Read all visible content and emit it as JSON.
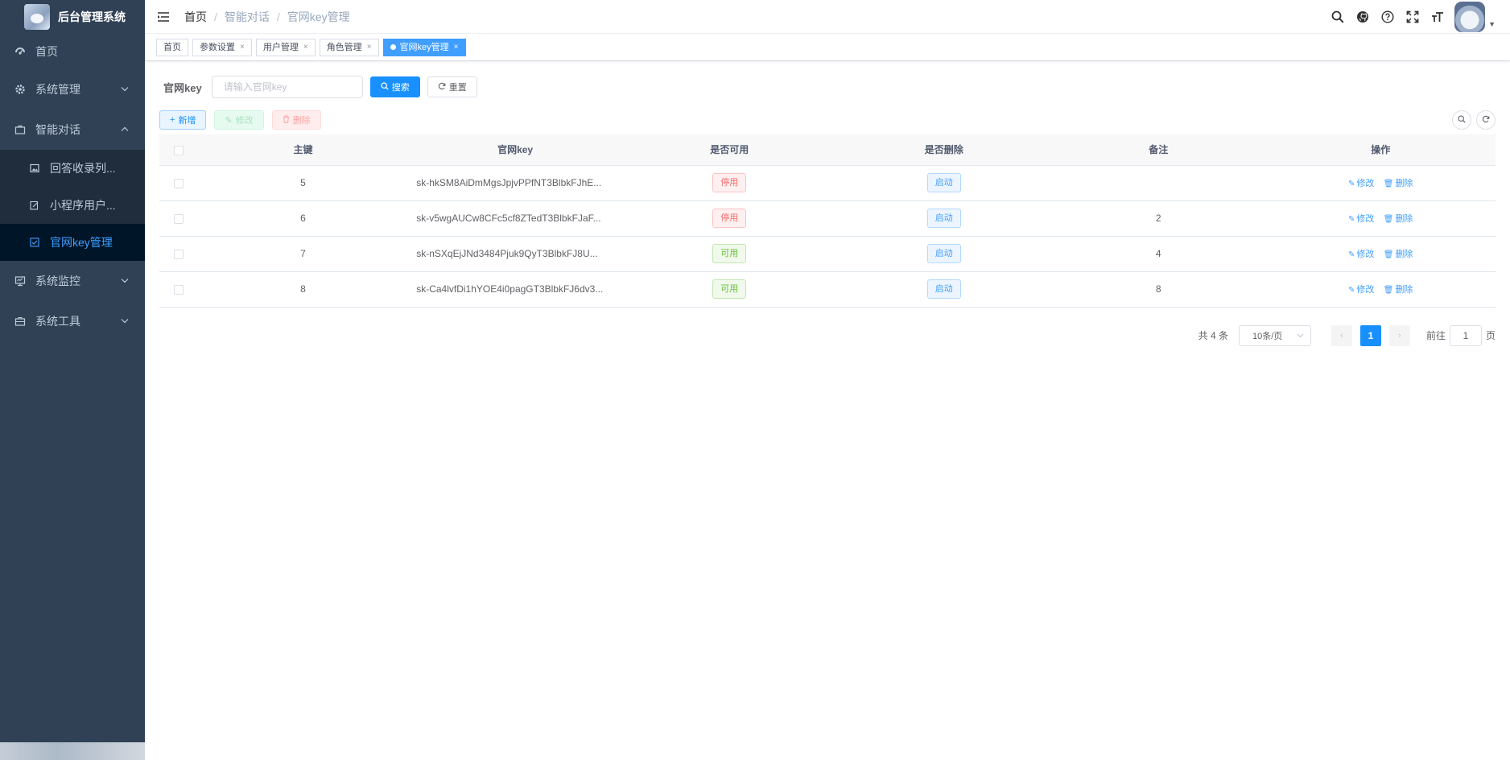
{
  "app": {
    "title": "后台管理系统"
  },
  "sidebar": {
    "items": [
      {
        "label": "首页",
        "icon": "dashboard-icon"
      },
      {
        "label": "系统管理",
        "icon": "gear-icon"
      },
      {
        "label": "智能对话",
        "icon": "briefcase-icon",
        "expanded": true,
        "children": [
          {
            "label": "回答收录列...",
            "icon": "image-icon"
          },
          {
            "label": "小程序用户...",
            "icon": "edit-icon"
          },
          {
            "label": "官网key管理",
            "icon": "checkbox-icon",
            "active": true
          }
        ]
      },
      {
        "label": "系统监控",
        "icon": "monitor-icon"
      },
      {
        "label": "系统工具",
        "icon": "toolbox-icon"
      }
    ]
  },
  "navbar": {
    "breadcrumb": [
      "首页",
      "智能对话",
      "官网key管理"
    ],
    "icons": [
      "search-icon",
      "github-icon",
      "question-icon",
      "fullscreen-icon",
      "font-size-icon"
    ]
  },
  "tags": [
    {
      "label": "首页",
      "closable": false
    },
    {
      "label": "参数设置",
      "closable": true
    },
    {
      "label": "用户管理",
      "closable": true
    },
    {
      "label": "角色管理",
      "closable": true
    },
    {
      "label": "官网key管理",
      "closable": true,
      "active": true
    }
  ],
  "search": {
    "label": "官网key",
    "placeholder": "请输入官网key",
    "value": "",
    "search_btn": "搜索",
    "reset_btn": "重置"
  },
  "toolbar": {
    "add": "新增",
    "edit": "修改",
    "delete": "删除"
  },
  "table": {
    "columns": [
      "主键",
      "官网key",
      "是否可用",
      "是否删除",
      "备注",
      "操作"
    ],
    "rows": [
      {
        "id": "5",
        "key": "sk-hkSM8AiDmMgsJpjvPPfNT3BlbkFJhE...",
        "enabled": "停用",
        "enabled_type": "red",
        "deleted": "启动",
        "remark": ""
      },
      {
        "id": "6",
        "key": "sk-v5wgAUCw8CFc5cf8ZTedT3BlbkFJaF...",
        "enabled": "停用",
        "enabled_type": "red",
        "deleted": "启动",
        "remark": "2"
      },
      {
        "id": "7",
        "key": "sk-nSXqEjJNd3484Pjuk9QyT3BlbkFJ8U...",
        "enabled": "可用",
        "enabled_type": "green",
        "deleted": "启动",
        "remark": "4"
      },
      {
        "id": "8",
        "key": "sk-Ca4lvfDi1hYOE4i0pagGT3BlbkFJ6dv3...",
        "enabled": "可用",
        "enabled_type": "green",
        "deleted": "启动",
        "remark": "8"
      }
    ],
    "row_actions": {
      "edit": "修改",
      "delete": "删除"
    }
  },
  "pagination": {
    "total": "共 4 条",
    "page_size": "10条/页",
    "current": "1",
    "goto_label": "前往",
    "goto_value": "1",
    "page_suffix": "页"
  },
  "colors": {
    "sidebar_bg": "#304156",
    "primary": "#1890ff",
    "danger": "#f56c6c",
    "success": "#67c23a"
  }
}
